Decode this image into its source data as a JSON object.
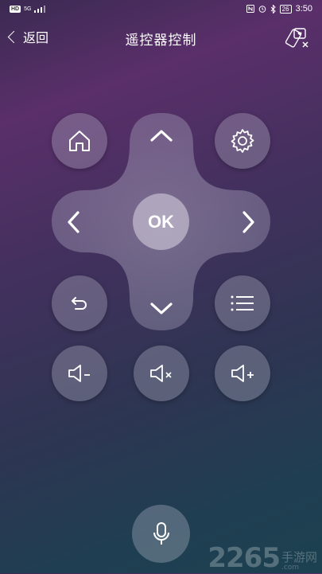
{
  "status_bar": {
    "left_badge": "HD",
    "network": "5G",
    "battery": "26",
    "time": "3:50"
  },
  "header": {
    "back_label": "返回",
    "title": "遥控器控制"
  },
  "remote": {
    "ok_label": "OK",
    "icons": {
      "home": "home-icon",
      "settings": "gear-icon",
      "up": "chevron-up-icon",
      "down": "chevron-down-icon",
      "left": "chevron-left-icon",
      "right": "chevron-right-icon",
      "back": "return-icon",
      "menu": "menu-icon",
      "vol_down": "volume-down-icon",
      "mute": "volume-mute-icon",
      "vol_up": "volume-up-icon",
      "mic": "microphone-icon"
    }
  },
  "watermark": {
    "number": "2265",
    "text_cn": "手游网",
    "domain": ".com"
  }
}
